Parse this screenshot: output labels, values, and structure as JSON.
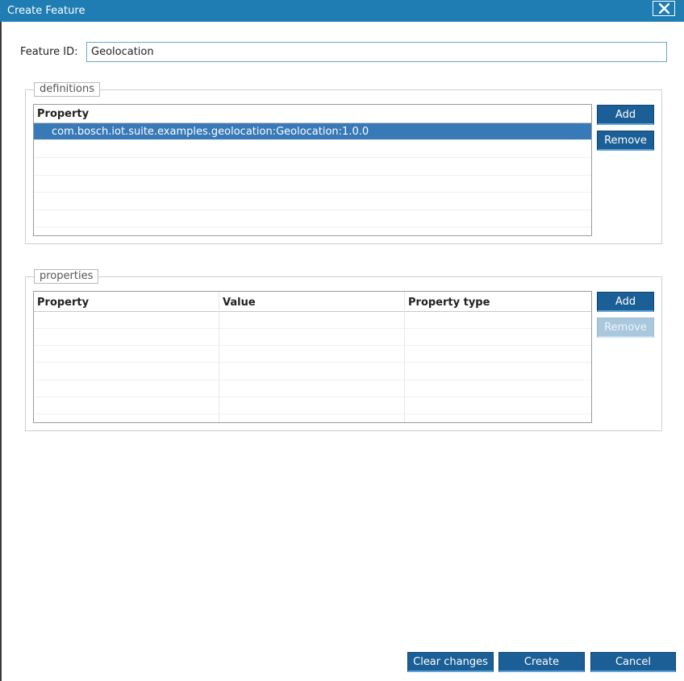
{
  "dialog": {
    "title": "Create Feature",
    "close_icon": "close-icon"
  },
  "feature_id": {
    "label": "Feature ID:",
    "value": "Geolocation"
  },
  "definitions": {
    "legend": "definitions",
    "columns": [
      "Property"
    ],
    "rows": [
      "com.bosch.iot.suite.examples.geolocation:Geolocation:1.0.0"
    ],
    "selected_row": 0,
    "add_label": "Add",
    "remove_label": "Remove"
  },
  "properties": {
    "legend": "properties",
    "columns": [
      "Property",
      "Value",
      "Property type"
    ],
    "rows": [],
    "add_label": "Add",
    "remove_label": "Remove",
    "remove_enabled": false
  },
  "footer": {
    "clear_label": "Clear changes",
    "create_label": "Create",
    "cancel_label": "Cancel"
  }
}
